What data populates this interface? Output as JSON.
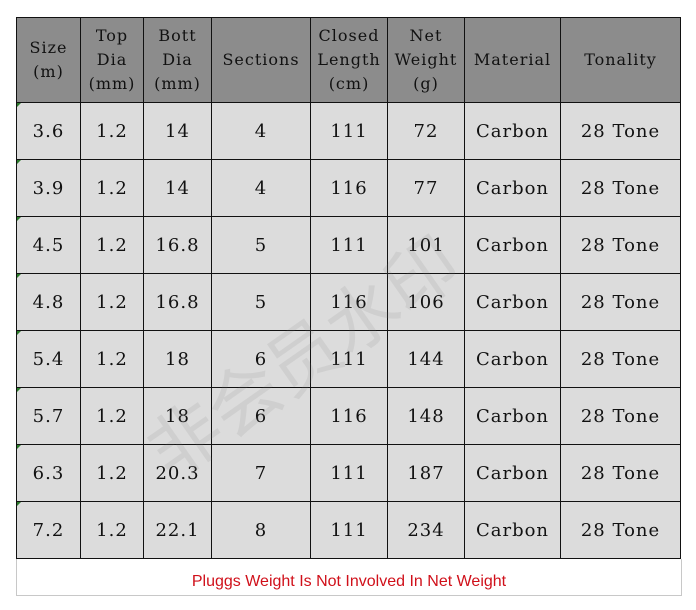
{
  "table": {
    "headers": [
      "Size\n(m)",
      "Top\nDia\n(mm)",
      "Bott\nDia\n(mm)",
      "Sections",
      "Closed\nLength\n(cm)",
      "Net\nWeight\n(g)",
      "Material",
      "Tonality"
    ],
    "rows": [
      [
        "3.6",
        "1.2",
        "14",
        "4",
        "111",
        "72",
        "Carbon",
        "28 Tone"
      ],
      [
        "3.9",
        "1.2",
        "14",
        "4",
        "116",
        "77",
        "Carbon",
        "28 Tone"
      ],
      [
        "4.5",
        "1.2",
        "16.8",
        "5",
        "111",
        "101",
        "Carbon",
        "28 Tone"
      ],
      [
        "4.8",
        "1.2",
        "16.8",
        "5",
        "116",
        "106",
        "Carbon",
        "28 Tone"
      ],
      [
        "5.4",
        "1.2",
        "18",
        "6",
        "111",
        "144",
        "Carbon",
        "28 Tone"
      ],
      [
        "5.7",
        "1.2",
        "18",
        "6",
        "116",
        "148",
        "Carbon",
        "28 Tone"
      ],
      [
        "6.3",
        "1.2",
        "20.3",
        "7",
        "111",
        "187",
        "Carbon",
        "28 Tone"
      ],
      [
        "7.2",
        "1.2",
        "22.1",
        "8",
        "111",
        "234",
        "Carbon",
        "28 Tone"
      ]
    ]
  },
  "footer_note": "Pluggs Weight Is Not Involved In  Net Weight",
  "watermark": "非会员水印",
  "colors": {
    "header_bg": "#8c8c8c",
    "cell_bg": "#dcdcdc",
    "note": "#d0101a"
  }
}
